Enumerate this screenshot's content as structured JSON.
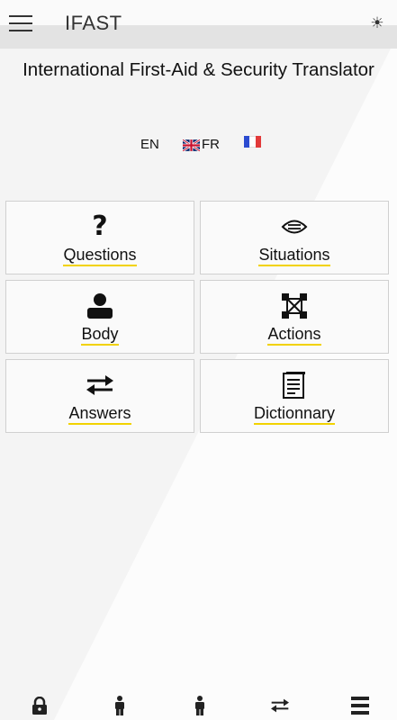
{
  "app": {
    "title": "IFAST",
    "theme_icon": "sun-icon"
  },
  "subtitle": "International First-Aid & Security Translator",
  "languages": {
    "source": "EN",
    "target": "FR"
  },
  "tiles": [
    {
      "label": "Questions",
      "icon": "question-icon"
    },
    {
      "label": "Situations",
      "icon": "eye-icon"
    },
    {
      "label": "Body",
      "icon": "person-icon"
    },
    {
      "label": "Actions",
      "icon": "actions-icon"
    },
    {
      "label": "Answers",
      "icon": "swap-arrows-icon"
    },
    {
      "label": "Dictionnary",
      "icon": "book-icon"
    }
  ],
  "bottom_nav": [
    "lock-icon",
    "person-icon",
    "person-icon",
    "swap-arrows-icon",
    "list-icon"
  ],
  "colors": {
    "accent_underline": "#f2d200",
    "appbar": "#e3e3e3",
    "background": "#f4f4f4"
  }
}
